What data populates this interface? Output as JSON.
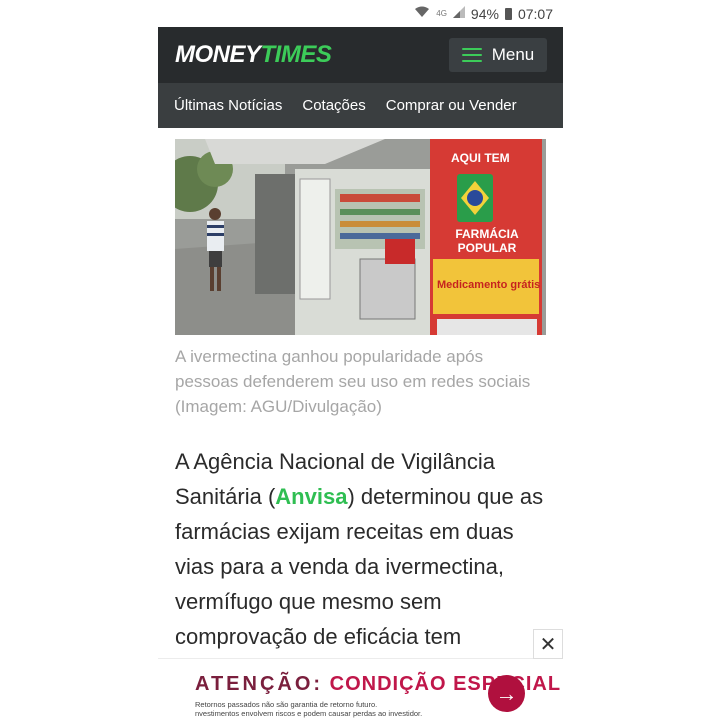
{
  "status_bar": {
    "network": "4G",
    "battery": "94%",
    "time": "07:07"
  },
  "header": {
    "logo_part1": "MONEY",
    "logo_part2": "TIMES",
    "menu_label": "Menu"
  },
  "nav": {
    "items": [
      {
        "label": "Últimas Notícias"
      },
      {
        "label": "Cotações"
      },
      {
        "label": "Comprar ou Vender"
      }
    ]
  },
  "hero": {
    "sign_top": "AQUI TEM",
    "sign_main": "FARMÁCIA POPULAR",
    "sign_banner": "Medicamento grátis"
  },
  "article": {
    "caption": "A ivermectina ganhou popularidade após pessoas defenderem seu uso em redes sociais (Imagem: AGU/Divulgação)",
    "body_before": "A Agência Nacional de Vigilância Sanitária (",
    "body_link": "Anvisa",
    "body_after": ") determinou que as farmácias exijam receitas em duas vias para a venda da ivermectina, vermífugo que mesmo sem comprovação de eficácia tem"
  },
  "ad": {
    "lead": "ATENÇÃO:",
    "highlight": "CONDIÇÃO ESPECIAL",
    "disclaimer_line1": "Retornos passados não são garantia de retorno futuro.",
    "disclaimer_line2": "nvestimentos envolvem riscos e podem causar perdas ao investidor.",
    "arrow": "→",
    "close": "✕"
  },
  "colors": {
    "brand_green": "#3ccc59",
    "header_bg": "#282b2d",
    "nav_bg": "#3a3e40",
    "ad_accent": "#b0103e"
  }
}
